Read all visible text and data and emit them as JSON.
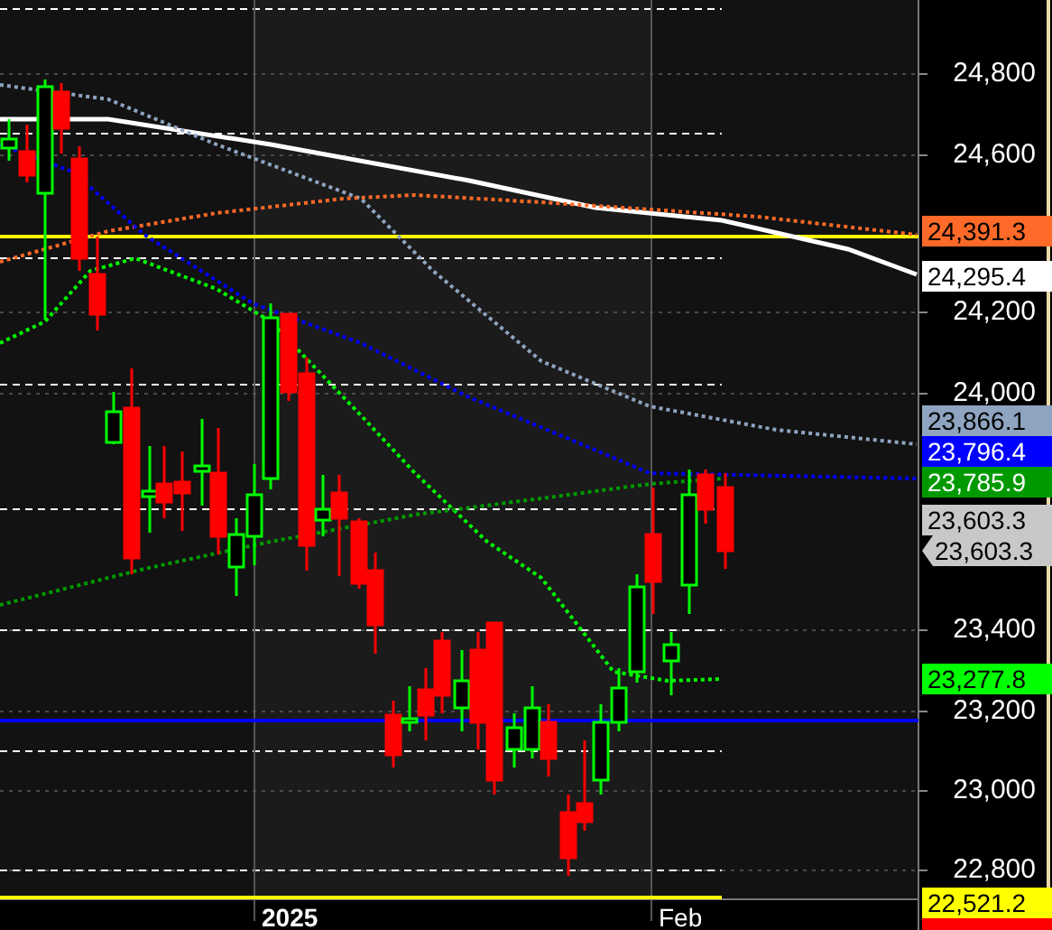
{
  "price_axis": {
    "ticks": [
      "24,800",
      "24,600",
      "24,200",
      "24,000",
      "23,400",
      "23,200",
      "23,000",
      "22,800"
    ]
  },
  "price_tags": [
    {
      "label": "24,391.3",
      "color": "#ff6a28",
      "kind": "flag"
    },
    {
      "label": "24,295.4",
      "color": "#ffffff",
      "kind": "flag"
    },
    {
      "label": "23,866.1",
      "color": "#8ea4c0",
      "kind": "flag"
    },
    {
      "label": "23,796.4",
      "color": "#0000ff",
      "kind": "flag"
    },
    {
      "label": "23,785.9",
      "color": "#009a00",
      "kind": "flag"
    },
    {
      "label": "23,603.3",
      "color": "#c8c8c8",
      "kind": "flag"
    },
    {
      "label": "23,603.3",
      "color": "#c8c8c8",
      "kind": "pointer"
    },
    {
      "label": "23,277.8",
      "color": "#00ff00",
      "kind": "flag"
    },
    {
      "label": "22,521.2",
      "color": "#ffff00",
      "kind": "flag"
    }
  ],
  "time_axis": {
    "labels": [
      "2025",
      "Feb"
    ]
  }
}
